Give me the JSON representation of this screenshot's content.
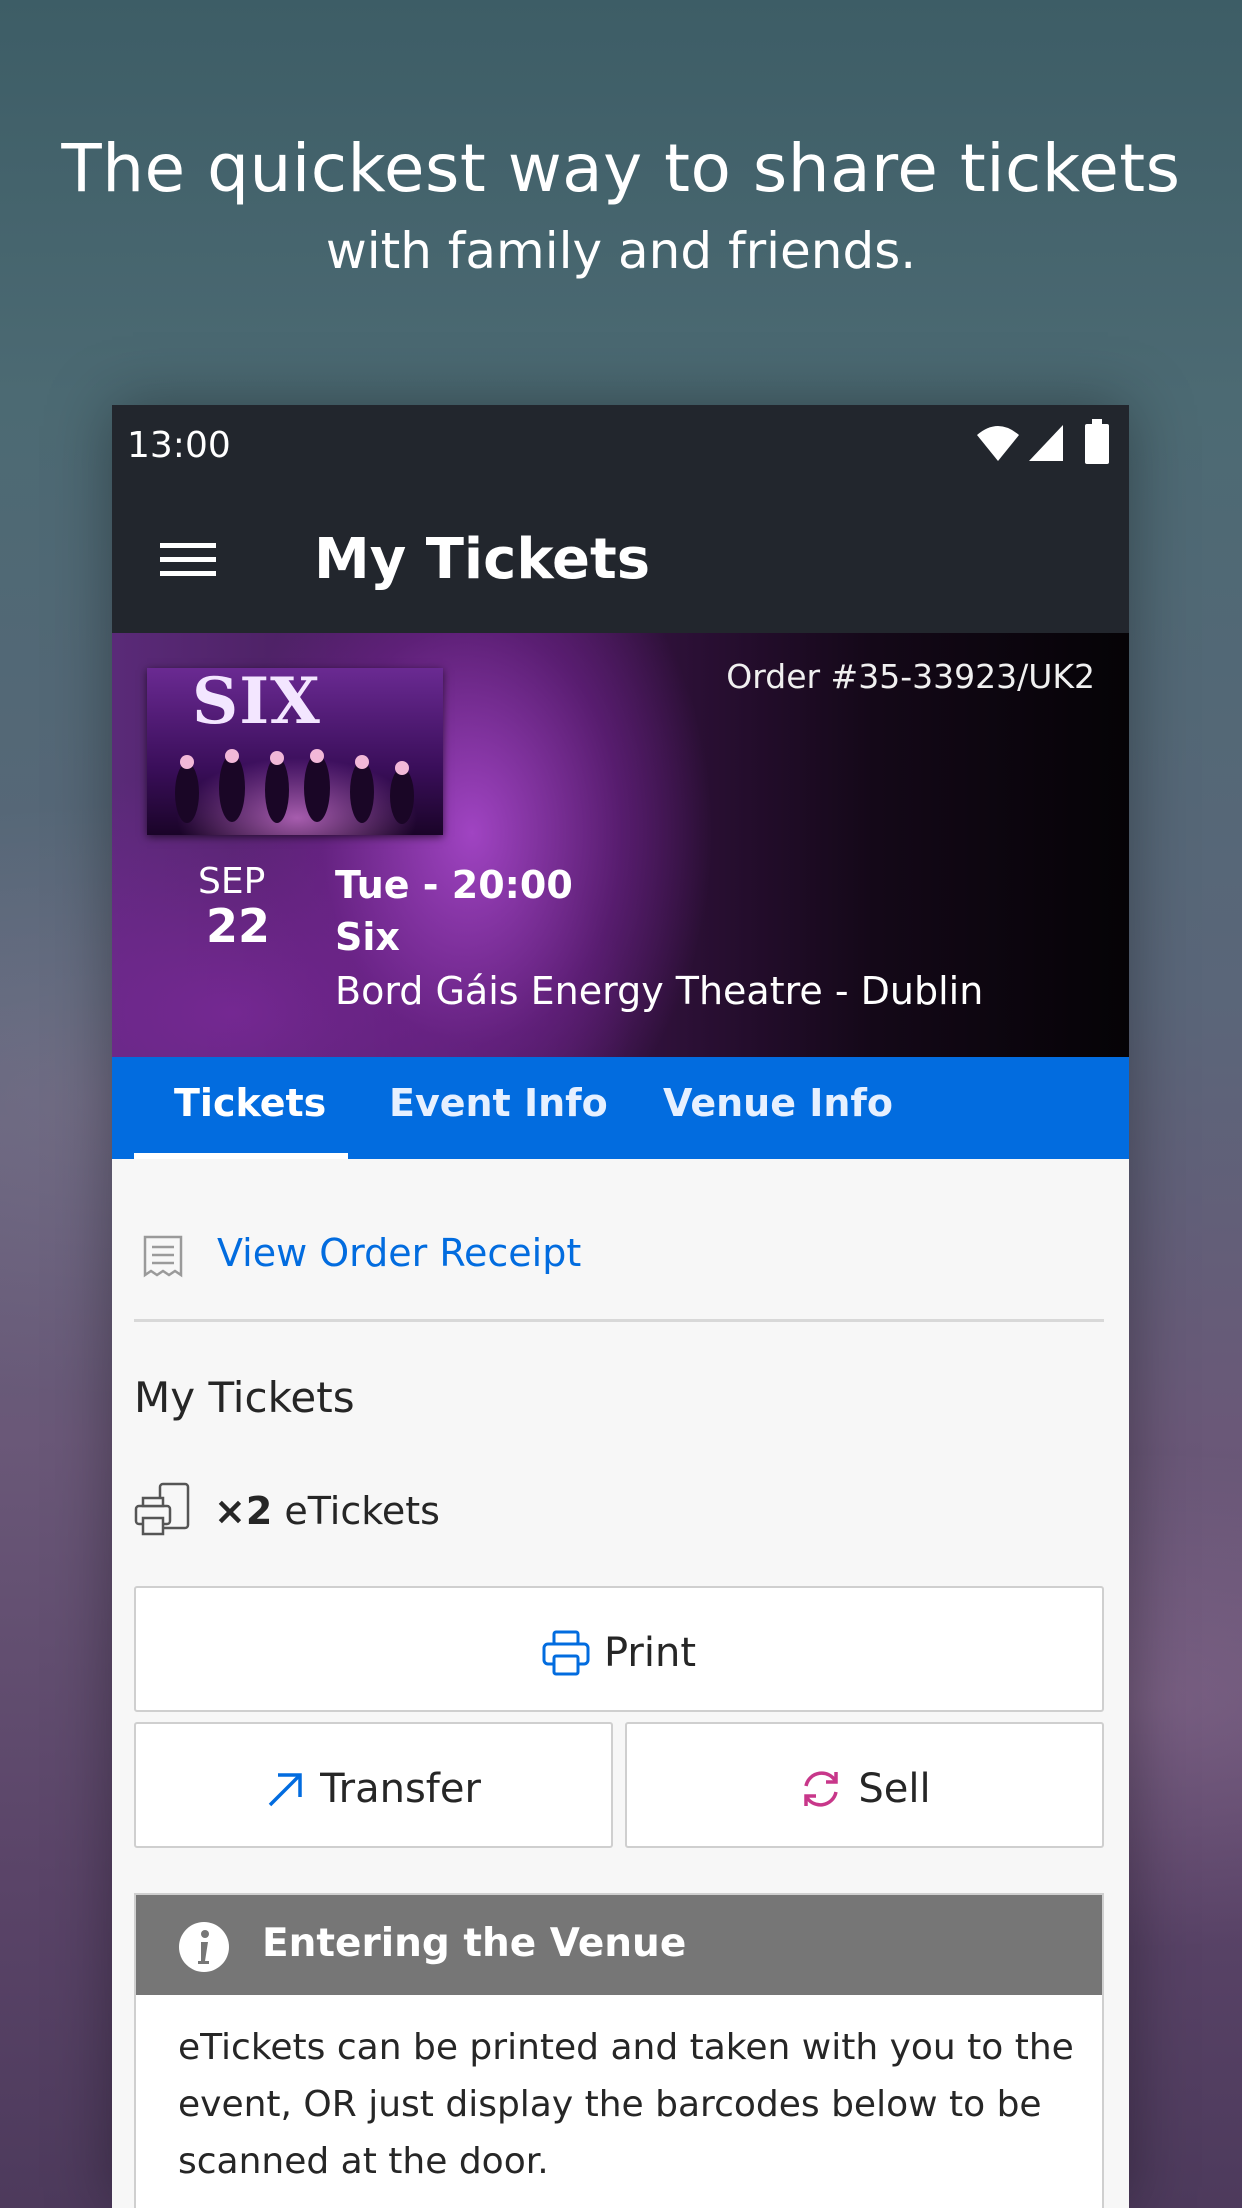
{
  "promo": {
    "headline": "The quickest way to share tickets",
    "subheadline": "with family and friends."
  },
  "status_bar": {
    "time": "13:00",
    "icons": [
      "wifi-icon",
      "signal-icon",
      "battery-icon"
    ]
  },
  "app_bar": {
    "menu_icon": "menu-icon",
    "title": "My Tickets"
  },
  "event": {
    "poster_text": "SIX",
    "order_number": "Order #35-33923/UK2",
    "month": "SEP",
    "day": "22",
    "when": "Tue - 20:00",
    "name": "Six",
    "venue": "Bord Gáis Energy Theatre - Dublin"
  },
  "tabs": [
    {
      "label": "Tickets",
      "active": true
    },
    {
      "label": "Event Info",
      "active": false
    },
    {
      "label": "Venue Info",
      "active": false
    }
  ],
  "receipt": {
    "icon": "receipt-icon",
    "label": "View Order Receipt"
  },
  "tickets": {
    "section_title": "My Tickets",
    "count_prefix": "×2",
    "count_label": "eTickets",
    "print_label": "Print",
    "transfer_label": "Transfer",
    "sell_label": "Sell"
  },
  "entering": {
    "title": "Entering the Venue",
    "body": "eTickets can be printed and taken with you to the event, OR just display the barcodes below to be scanned at the door."
  },
  "colors": {
    "brand_blue": "#026cdf",
    "app_bar": "#22262d",
    "sell_pink": "#c8378a",
    "info_header": "#767676"
  }
}
